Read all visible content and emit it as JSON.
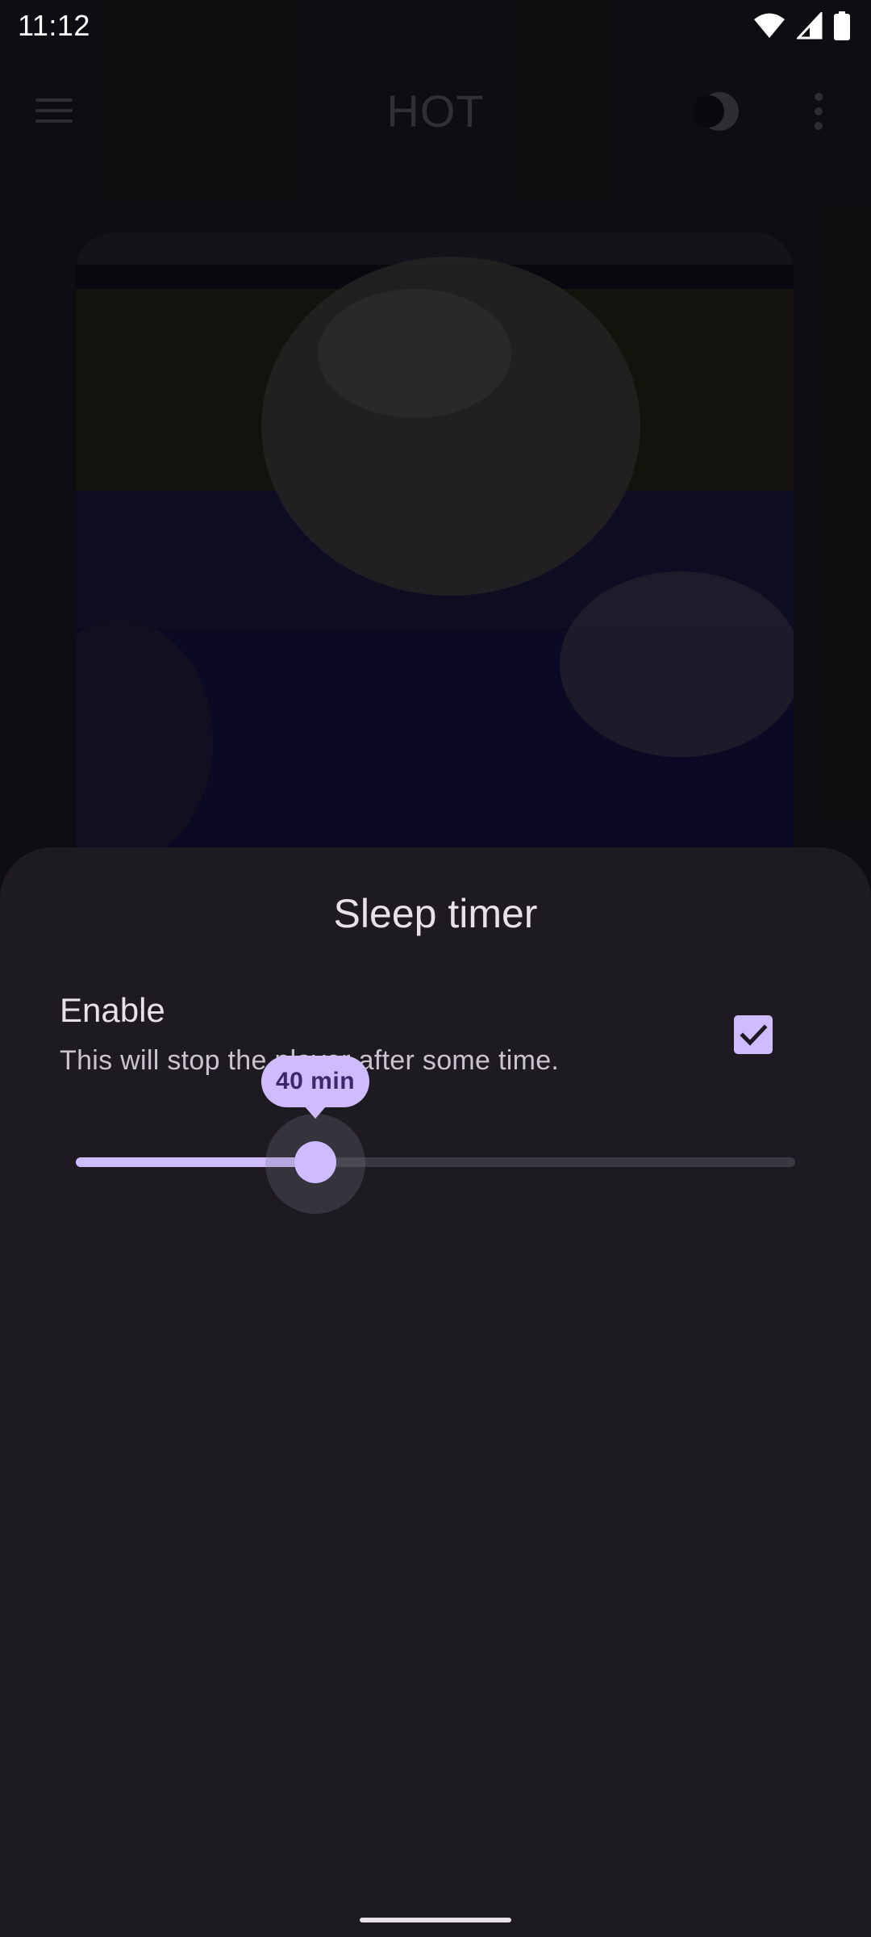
{
  "status_bar": {
    "time": "11:12",
    "icons": [
      "wifi-icon",
      "cell-signal-icon",
      "battery-icon"
    ]
  },
  "app_bar": {
    "title": "HOT",
    "menu_icon": "hamburger-menu-icon",
    "theme_icon": "moon-icon",
    "more_icon": "more-vert-icon"
  },
  "sleep_timer": {
    "title": "Sleep timer",
    "enable_label": "Enable",
    "enable_description": "This will stop the player after some time.",
    "enabled": true,
    "slider": {
      "value_label": "40 min",
      "fraction": 0.333
    }
  },
  "colors": {
    "accent": "#cfbcff",
    "sheet_background": "#1d1b21",
    "on_accent": "#3a2a6a",
    "inactive_track": "#3b3841"
  }
}
